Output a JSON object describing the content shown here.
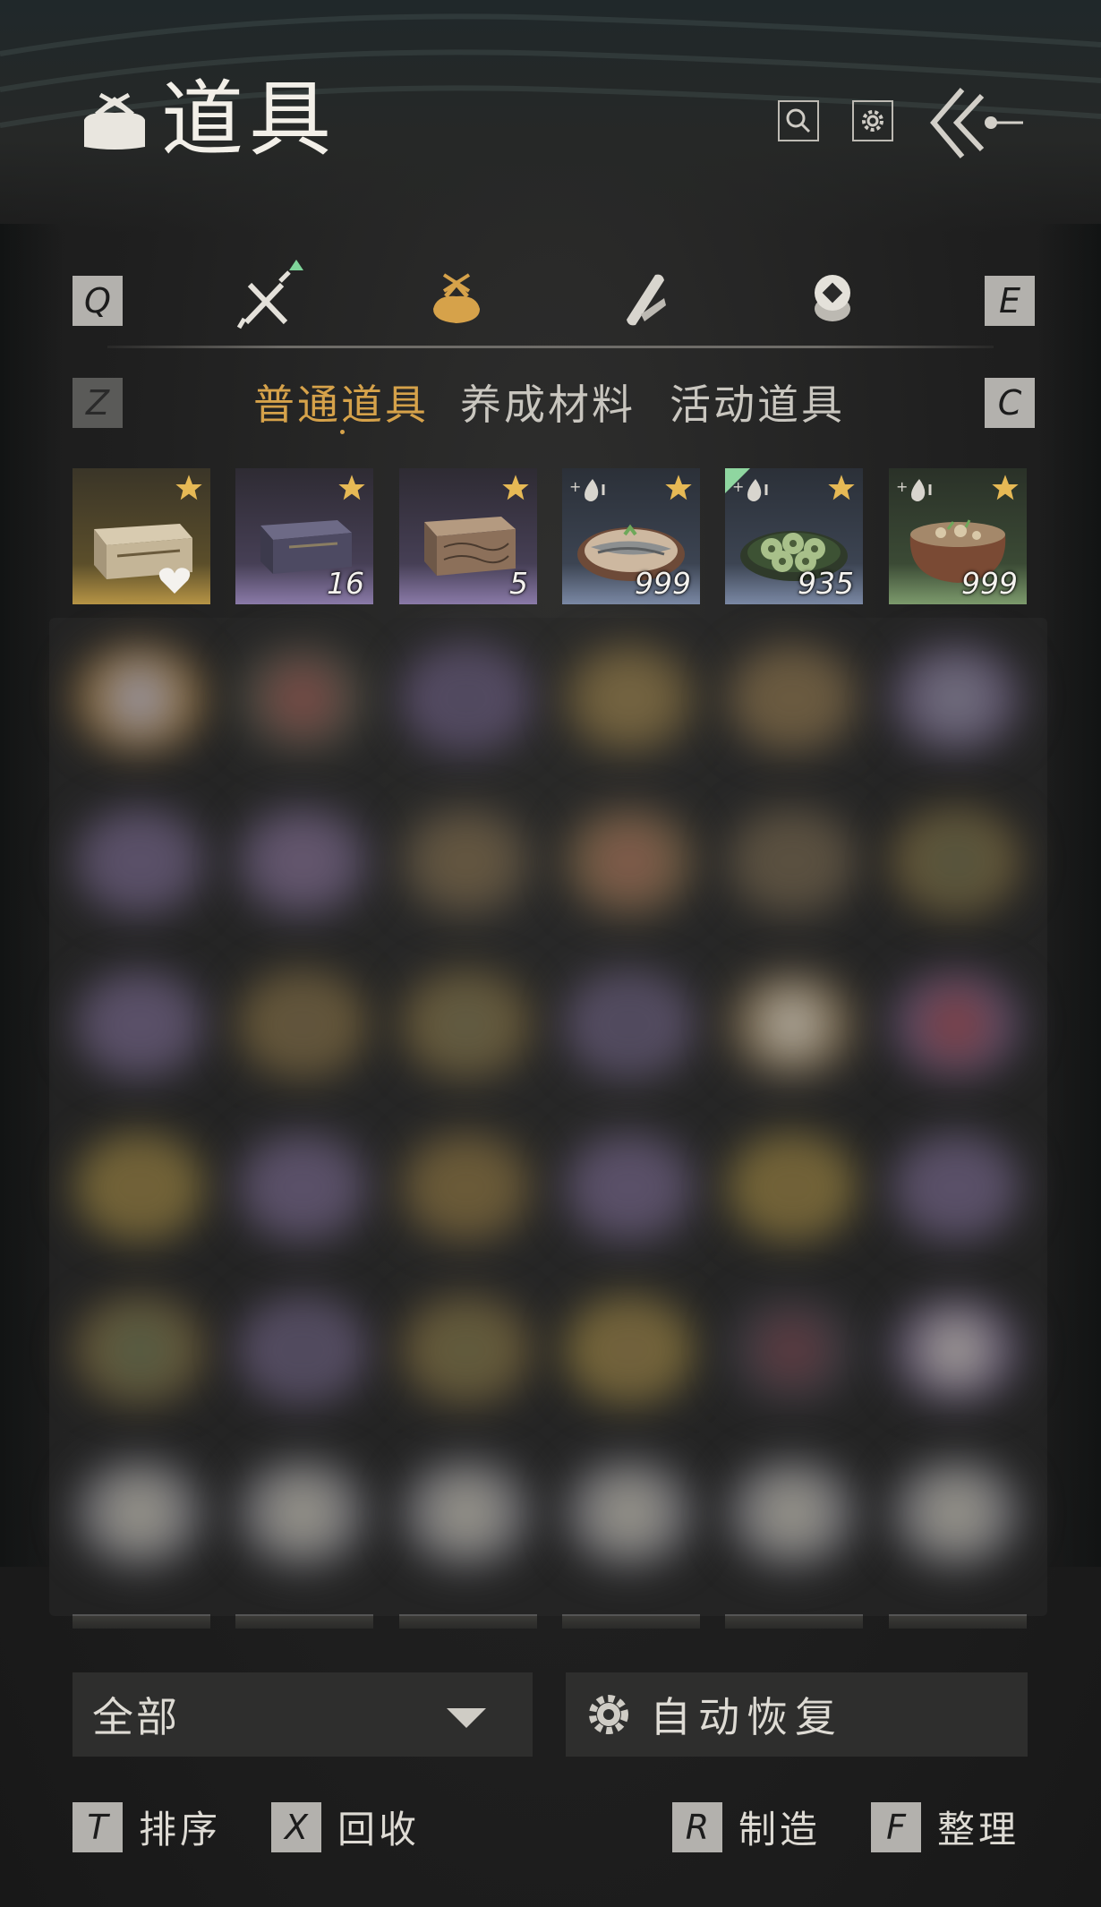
{
  "header": {
    "title": "道具",
    "icons": [
      "bundle-icon",
      "search-icon",
      "gear-icon",
      "back-arrow-icon"
    ]
  },
  "category_tabs": {
    "prev_key": "Q",
    "next_key": "E",
    "tabs": [
      {
        "icon": "weapon-icon",
        "active": false,
        "has_notice": true
      },
      {
        "icon": "bundle-icon",
        "active": true
      },
      {
        "icon": "scroll-icon",
        "active": false
      },
      {
        "icon": "token-icon",
        "active": false
      }
    ]
  },
  "sub_tabs": {
    "prev_key": "Z",
    "next_key": "C",
    "items": [
      {
        "label": "普通道具",
        "active": true
      },
      {
        "label": "养成材料",
        "active": false
      },
      {
        "label": "活动道具",
        "active": false
      }
    ]
  },
  "items": [
    {
      "icon": "gold-chest-icon",
      "quality": "gold",
      "quantity": "",
      "favorite": true
    },
    {
      "icon": "dark-chest-icon",
      "quality": "purple",
      "quantity": "16"
    },
    {
      "icon": "carved-chest-icon",
      "quality": "purple",
      "quantity": "5"
    },
    {
      "icon": "fish-dish-icon",
      "quality": "blue",
      "quantity": "999"
    },
    {
      "icon": "dumpling-dish-icon",
      "quality": "blue",
      "quantity": "935"
    },
    {
      "icon": "soup-pot-icon",
      "quality": "green",
      "quantity": "999"
    }
  ],
  "filter": {
    "selected": "全部"
  },
  "auto_restore": {
    "label": "自动恢复"
  },
  "actions": [
    {
      "key": "T",
      "label": "排序"
    },
    {
      "key": "X",
      "label": "回收"
    },
    {
      "key": "R",
      "label": "制造"
    },
    {
      "key": "F",
      "label": "整理"
    }
  ],
  "colors": {
    "accent": "#d6a24a",
    "text": "#dedbd4",
    "key_bg": "#b3b1ad",
    "panel": "#2e2e2d"
  }
}
